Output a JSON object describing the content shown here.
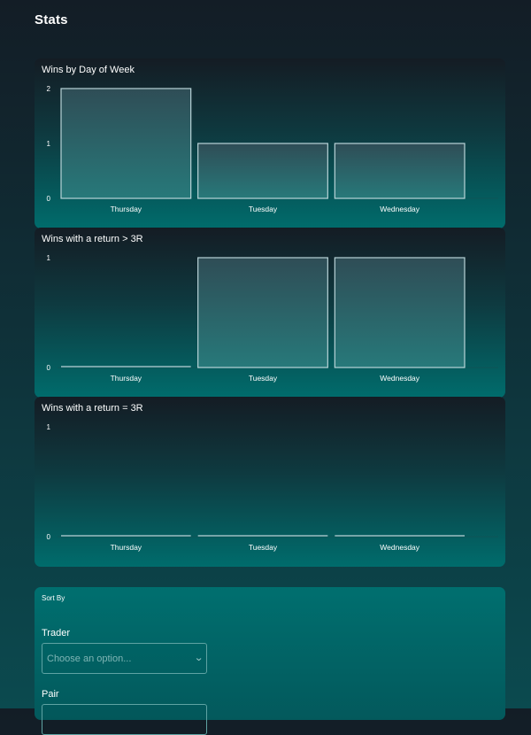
{
  "page": {
    "title": "Stats"
  },
  "charts": [
    {
      "title": "Wins by Day of Week",
      "type": "bar",
      "categories": [
        "Thursday",
        "Tuesday",
        "Wednesday"
      ],
      "values": [
        2,
        1,
        1
      ],
      "yticks": [
        0,
        1,
        2
      ],
      "ylim": [
        0,
        2
      ]
    },
    {
      "title": "Wins with a return > 3R",
      "type": "bar",
      "categories": [
        "Thursday",
        "Tuesday",
        "Wednesday"
      ],
      "values": [
        0,
        1,
        1
      ],
      "yticks": [
        0,
        1
      ],
      "ylim": [
        0,
        1
      ]
    },
    {
      "title": "Wins with a return = 3R",
      "type": "bar",
      "categories": [
        "Thursday",
        "Tuesday",
        "Wednesday"
      ],
      "values": [
        0,
        0,
        0
      ],
      "yticks": [
        0,
        1
      ],
      "ylim": [
        0,
        1
      ]
    }
  ],
  "chart_data": [
    {
      "type": "bar",
      "title": "Wins by Day of Week",
      "categories": [
        "Thursday",
        "Tuesday",
        "Wednesday"
      ],
      "values": [
        2,
        1,
        1
      ],
      "ylim": [
        0,
        2
      ]
    },
    {
      "type": "bar",
      "title": "Wins with a return > 3R",
      "categories": [
        "Thursday",
        "Tuesday",
        "Wednesday"
      ],
      "values": [
        0,
        1,
        1
      ],
      "ylim": [
        0,
        1
      ]
    },
    {
      "type": "bar",
      "title": "Wins with a return = 3R",
      "categories": [
        "Thursday",
        "Tuesday",
        "Wednesday"
      ],
      "values": [
        0,
        0,
        0
      ],
      "ylim": [
        0,
        1
      ]
    }
  ],
  "sort": {
    "label": "Sort By",
    "trader_label": "Trader",
    "trader_placeholder": "Choose an option...",
    "pair_label": "Pair"
  },
  "colors": {
    "bar_stroke": "#b9d4d8",
    "bar_fill_top": "#2f4d56",
    "bar_fill_bottom": "#27797a"
  }
}
